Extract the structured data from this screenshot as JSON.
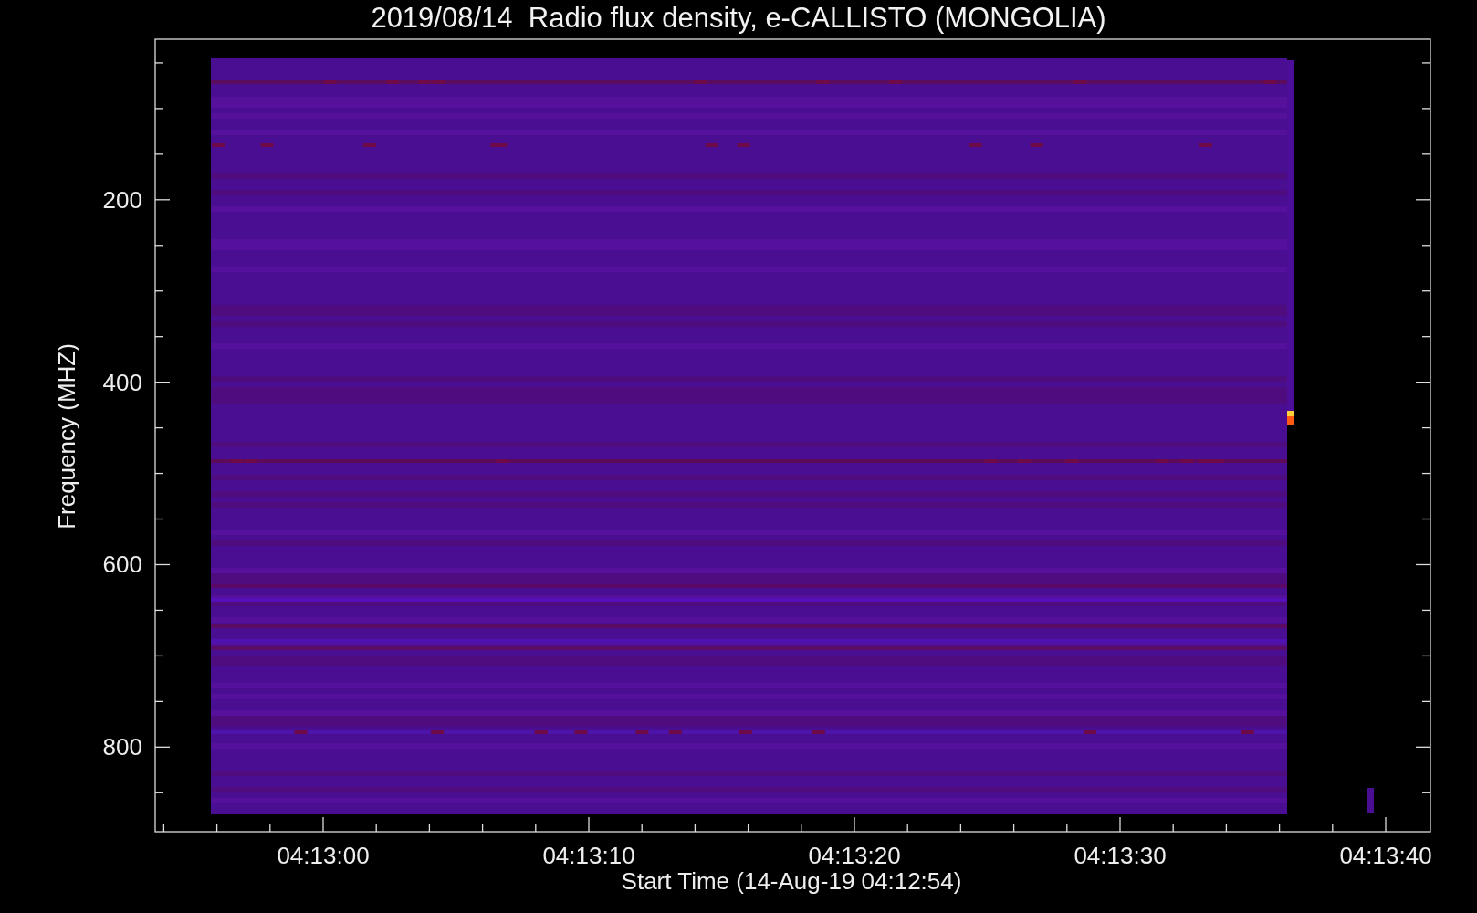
{
  "title": "2019/08/14  Radio flux density, e-CALLISTO (MONGOLIA)",
  "plot": {
    "xlabel": "Start Time (14-Aug-19 04:12:54)",
    "ylabel": "Frequency (MHZ)",
    "xticks": [
      "04:13:00",
      "04:13:10",
      "04:13:20",
      "04:13:30",
      "04:13:40"
    ],
    "yticks": [
      "200",
      "400",
      "600",
      "800"
    ]
  }
}
